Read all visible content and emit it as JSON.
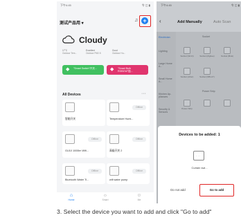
{
  "left_screen": {
    "status_time": "下午4:45",
    "status_icons": "令 ◫ ▮",
    "home_label": "测试产品用 ▾",
    "add_button_glyph": "+",
    "weather": {
      "location": "Cloudy",
      "stats": [
        {
          "value": "17°C",
          "label": "Outdoor Tem..."
        },
        {
          "value": "Excellent",
          "label": "Outdoor PM2.5"
        },
        {
          "value": "Good",
          "label": "Outdoor Hu..."
        }
      ]
    },
    "scenes": [
      "\"Smart Switch\"开关...",
      "\"Smart Bulb RGBCW\"插..."
    ],
    "devices_header": "All Devices",
    "more_glyph": "···",
    "devices": [
      {
        "name": "智能开关",
        "status": ""
      },
      {
        "name": "Temperature Humi...",
        "status": "Offline"
      },
      {
        "name": "GU10 1000lm Wifi...",
        "status": "Offline"
      },
      {
        "name": "高级开关 2",
        "status": "Offline"
      },
      {
        "name": "Bluetooth Water Ti...",
        "status": "Offline"
      },
      {
        "name": "wifi water pump",
        "status": "Offline"
      }
    ],
    "tabs": [
      {
        "label": "Home",
        "icon": "home-icon"
      },
      {
        "label": "Smart",
        "icon": "smart-icon"
      },
      {
        "label": "Me",
        "icon": "me-icon"
      }
    ],
    "accent_color": "#1e80f0",
    "highlight_color": "#e02424"
  },
  "right_screen": {
    "status_time": "下午4:45",
    "status_icons": "令 ◫ ▮",
    "tab_manual": "Add Manually",
    "tab_auto": "Auto Scan",
    "categories": [
      "Electrician",
      "Lighting",
      "Large Home A...",
      "Small Home A...",
      "Kitchen Ap-pliances",
      "Security & Sensors"
    ],
    "section_titles": [
      "Socket",
      "Power Strip"
    ],
    "grid_devices": [
      {
        "label": "Socket (Wi-Fi)"
      },
      {
        "label": "Socket (Zigbee)"
      },
      {
        "label": "Socket (BLE)"
      },
      {
        "label": "Socket (other)"
      },
      {
        "label": "Socket (NB-IoT)"
      },
      {
        "label": "Power Strip"
      }
    ],
    "dialog": {
      "title": "Devices to be added: 1",
      "device_name": "Curtain swi...",
      "cancel_label": "Do not add",
      "confirm_label": "Go to add"
    }
  },
  "caption": "3. Select the device you want to add and click \"Go to add\""
}
